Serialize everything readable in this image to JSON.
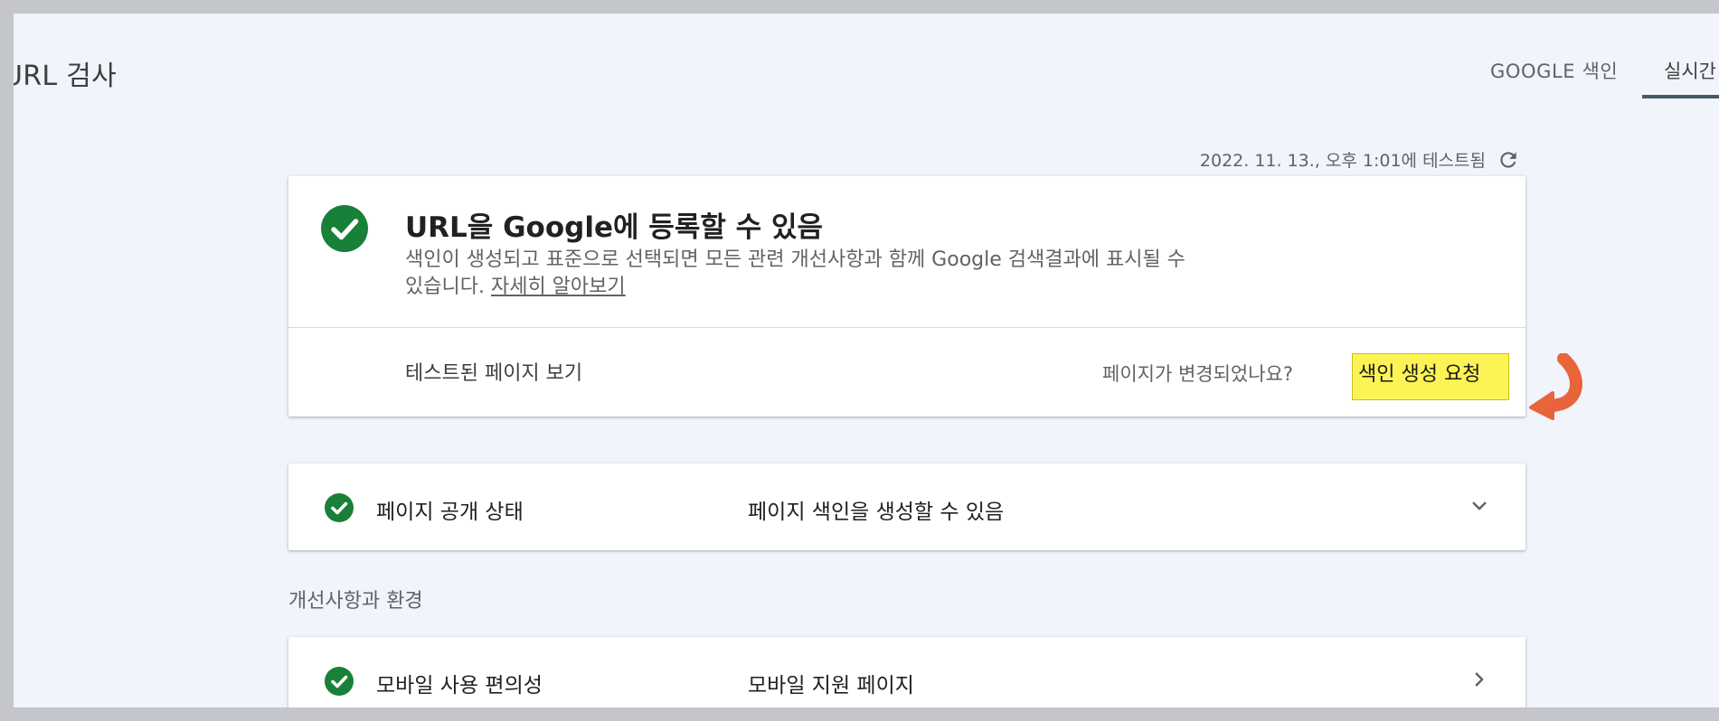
{
  "header": {
    "title": "URL 검사",
    "tabs": [
      {
        "label": "GOOGLE 색인"
      },
      {
        "label": "실시간"
      }
    ]
  },
  "tested": {
    "text": "2022. 11. 13., 오후 1:01에 테스트됨",
    "icon": "refresh-icon"
  },
  "status_card": {
    "headline": "URL을 Google에 등록할 수 있음",
    "description": "색인이 생성되고 표준으로 선택되면 모든 관련 개선사항과 함께 Google 검색결과에 표시될 수 있습니다.",
    "learn_more": "자세히 알아보기",
    "view_tested_page": "테스트된 페이지 보기",
    "changed_question": "페이지가 변경되었나요?",
    "request_indexing": "색인 생성 요청"
  },
  "coverage": {
    "label": "페이지 공개 상태",
    "value": "페이지 색인을 생성할 수 있음"
  },
  "enhancements": {
    "heading": "개선사항과 환경",
    "items": [
      {
        "label": "모바일 사용 편의성",
        "value": "모바일 지원 페이지"
      }
    ]
  },
  "colors": {
    "success_green": "#188038",
    "highlight_yellow": "#fcf455",
    "annotation_arrow": "#e8643a",
    "tab_indicator": "#455a64"
  }
}
